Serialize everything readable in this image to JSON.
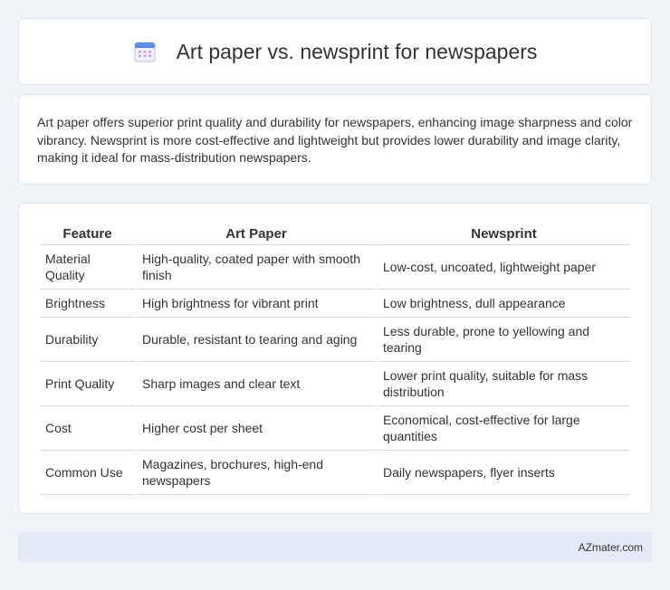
{
  "header": {
    "title": "Art paper vs. newsprint for newspapers",
    "icon": "calendar-icon",
    "icon_colors": {
      "top": "#5b8de6",
      "body": "#f2eefa",
      "dots": "#c5a8e8"
    }
  },
  "summary": {
    "text": "Art paper offers superior print quality and durability for newspapers, enhancing image sharpness and color vibrancy. Newsprint is more cost-effective and lightweight but provides lower durability and image clarity, making it ideal for mass-distribution newspapers."
  },
  "table": {
    "headers": [
      "Feature",
      "Art Paper",
      "Newsprint"
    ],
    "rows": [
      [
        "Material Quality",
        "High-quality, coated paper with smooth finish",
        "Low-cost, uncoated, lightweight paper"
      ],
      [
        "Brightness",
        "High brightness for vibrant print",
        "Low brightness, dull appearance"
      ],
      [
        "Durability",
        "Durable, resistant to tearing and aging",
        "Less durable, prone to yellowing and tearing"
      ],
      [
        "Print Quality",
        "Sharp images and clear text",
        "Lower print quality, suitable for mass distribution"
      ],
      [
        "Cost",
        "Higher cost per sheet",
        "Economical, cost-effective for large quantities"
      ],
      [
        "Common Use",
        "Magazines, brochures, high-end newspapers",
        "Daily newspapers, flyer inserts"
      ]
    ]
  },
  "footer": {
    "brand": "AZmater.com"
  },
  "colors": {
    "page_background": "#f1f4f9",
    "card_background": "#ffffff",
    "footer_background": "#e4eaf6",
    "text": "#333333"
  }
}
